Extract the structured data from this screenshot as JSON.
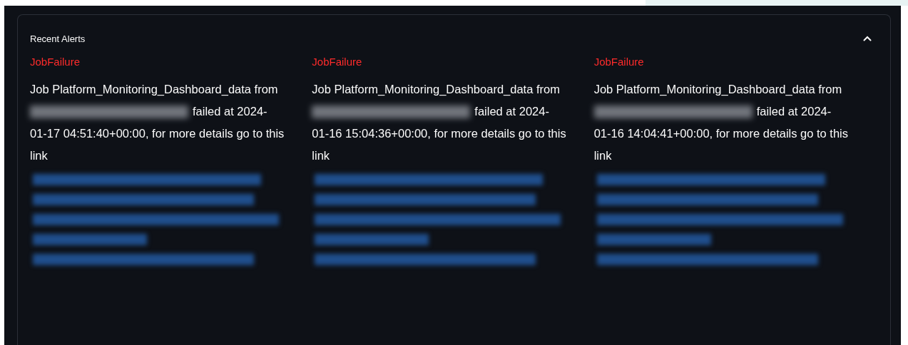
{
  "panel": {
    "title": "Recent Alerts",
    "expanded": true
  },
  "alerts": [
    {
      "type": "JobFailure",
      "message_before": "Job Platform_Monitoring_Dashboard_data from",
      "workspace_redacted": true,
      "message_failed": "failed at 2024-",
      "message_after": "01-17 04:51:40+00:00, for more details go to this link",
      "link_redacted": true
    },
    {
      "type": "JobFailure",
      "message_before": "Job Platform_Monitoring_Dashboard_data from",
      "workspace_redacted": true,
      "message_failed": "failed at 2024-",
      "message_after": "01-16 15:04:36+00:00, for more details go to this link",
      "link_redacted": true
    },
    {
      "type": "JobFailure",
      "message_before": "Job Platform_Monitoring_Dashboard_data from",
      "workspace_redacted": true,
      "message_failed": "failed at 2024-",
      "message_after": "01-16 14:04:41+00:00, for more details go to this link",
      "link_redacted": true
    }
  ]
}
